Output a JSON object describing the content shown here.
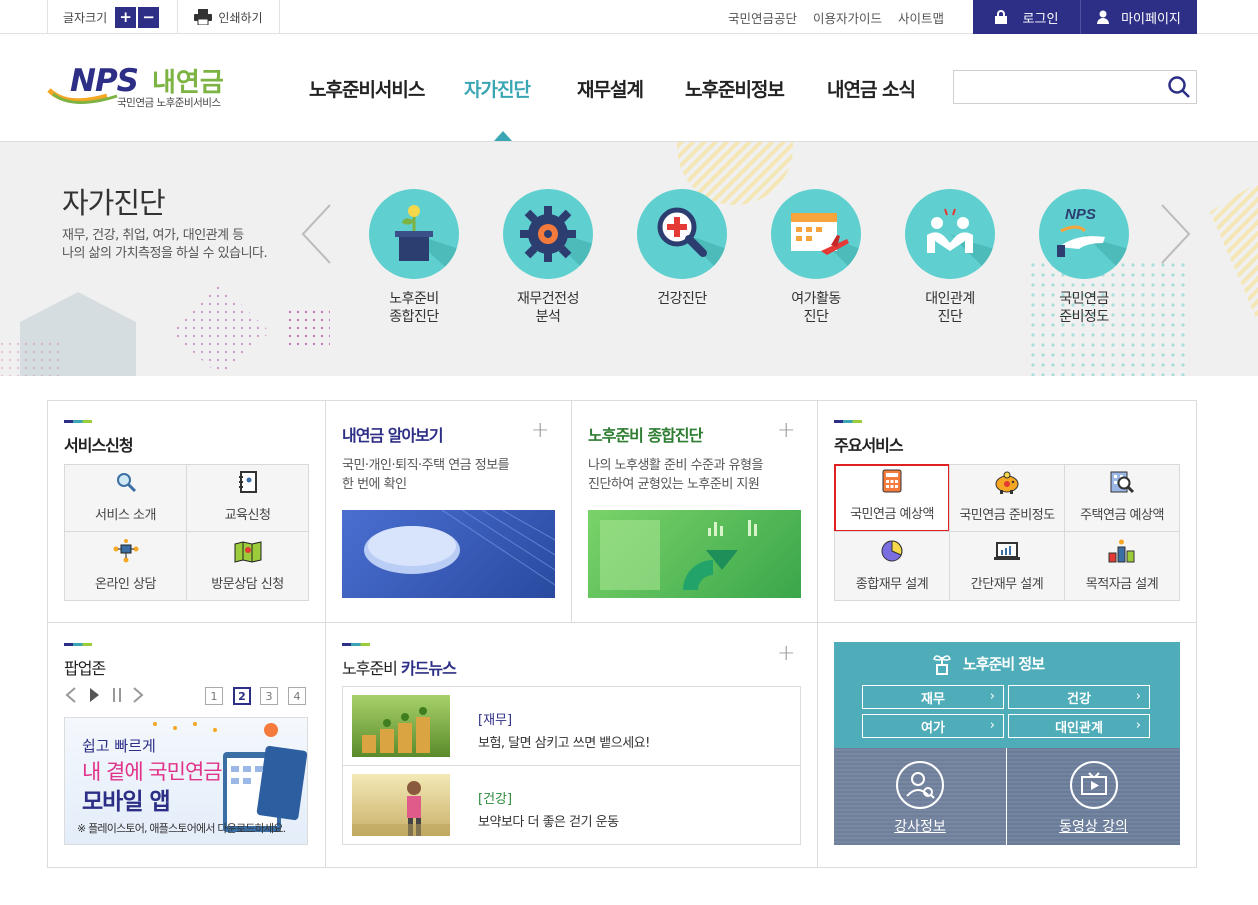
{
  "topbar": {
    "font_label": "글자크기",
    "font_plus": "+",
    "font_minus": "−",
    "print_label": "인쇄하기",
    "links": [
      "국민연금공단",
      "이용자가이드",
      "사이트맵"
    ],
    "login": "로그인",
    "mypage": "마이페이지"
  },
  "logo": {
    "nps": "NPS",
    "mine": "내연금",
    "sub": "국민연금 노후준비서비스"
  },
  "gnb": [
    "노후준비서비스",
    "자가진단",
    "재무설계",
    "노후준비정보",
    "내연금 소식"
  ],
  "gnb_active": "자가진단",
  "search": {
    "placeholder": ""
  },
  "hero": {
    "title": "자가진단",
    "desc_1": "재무, 건강, 취업, 여가, 대인관계 등",
    "desc_2": "나의 삶의 가치측정을 하실 수 있습니다.",
    "items": [
      {
        "l1": "노후준비",
        "l2": "종합진단",
        "icon": "plant-pot-icon"
      },
      {
        "l1": "재무건전성",
        "l2": "분석",
        "icon": "gear-icon"
      },
      {
        "l1": "건강진단",
        "l2": "",
        "icon": "magnifier-cross-icon"
      },
      {
        "l1": "여가활동",
        "l2": "진단",
        "icon": "calendar-plane-icon"
      },
      {
        "l1": "대인관계",
        "l2": "진단",
        "icon": "people-icon"
      },
      {
        "l1": "국민연금",
        "l2": "준비정도",
        "icon": "nps-hand-icon"
      }
    ],
    "circle_color": "#5fd0cf"
  },
  "service": {
    "title": "서비스신청",
    "items": [
      "서비스 소개",
      "교육신청",
      "온라인 상담",
      "방문상담 신청"
    ]
  },
  "learn": {
    "title": "내연금 알아보기",
    "desc_1": "국민·개인·퇴직·주택 연금 정보를",
    "desc_2": "한 번에 확인"
  },
  "diag": {
    "title": "노후준비 종합진단",
    "desc_1": "나의 노후생활 준비 수준과 유형을",
    "desc_2": "진단하여 균형있는 노후준비 지원"
  },
  "main_services": {
    "title": "주요서비스",
    "items": [
      "국민연금 예상액",
      "국민연금 준비정도",
      "주택연금 예상액",
      "종합재무 설계",
      "간단재무 설계",
      "목적자금 설계"
    ],
    "highlight_color": "#e02020"
  },
  "popup": {
    "title": "팝업존",
    "pages": [
      "1",
      "2",
      "3",
      "4"
    ],
    "current_page": "2",
    "banner_1": "쉽고 빠르게",
    "banner_2": "내 곁에 국민연금",
    "banner_3": "모바일 앱",
    "banner_note": "※ 플레이스토어, 애플스토어에서 다운로드하세요."
  },
  "cardnews": {
    "title_1": "노후준비 ",
    "title_2": "카드뉴스",
    "items": [
      {
        "tag": "[재무]",
        "text": "보험, 달면 삼키고 쓰면 뱉으세요!"
      },
      {
        "tag": "[건강]",
        "text": "보약보다 더 좋은 걷기 운동"
      }
    ]
  },
  "info": {
    "title": "노후준비 정보",
    "buttons": [
      "재무",
      "건강",
      "여가",
      "대인관계"
    ],
    "lecturer": "강사정보",
    "video": "동영상 강의"
  },
  "colors": {
    "brand": "#2d2f86",
    "accent": "#3aa6b4",
    "green": "#7cb342"
  }
}
